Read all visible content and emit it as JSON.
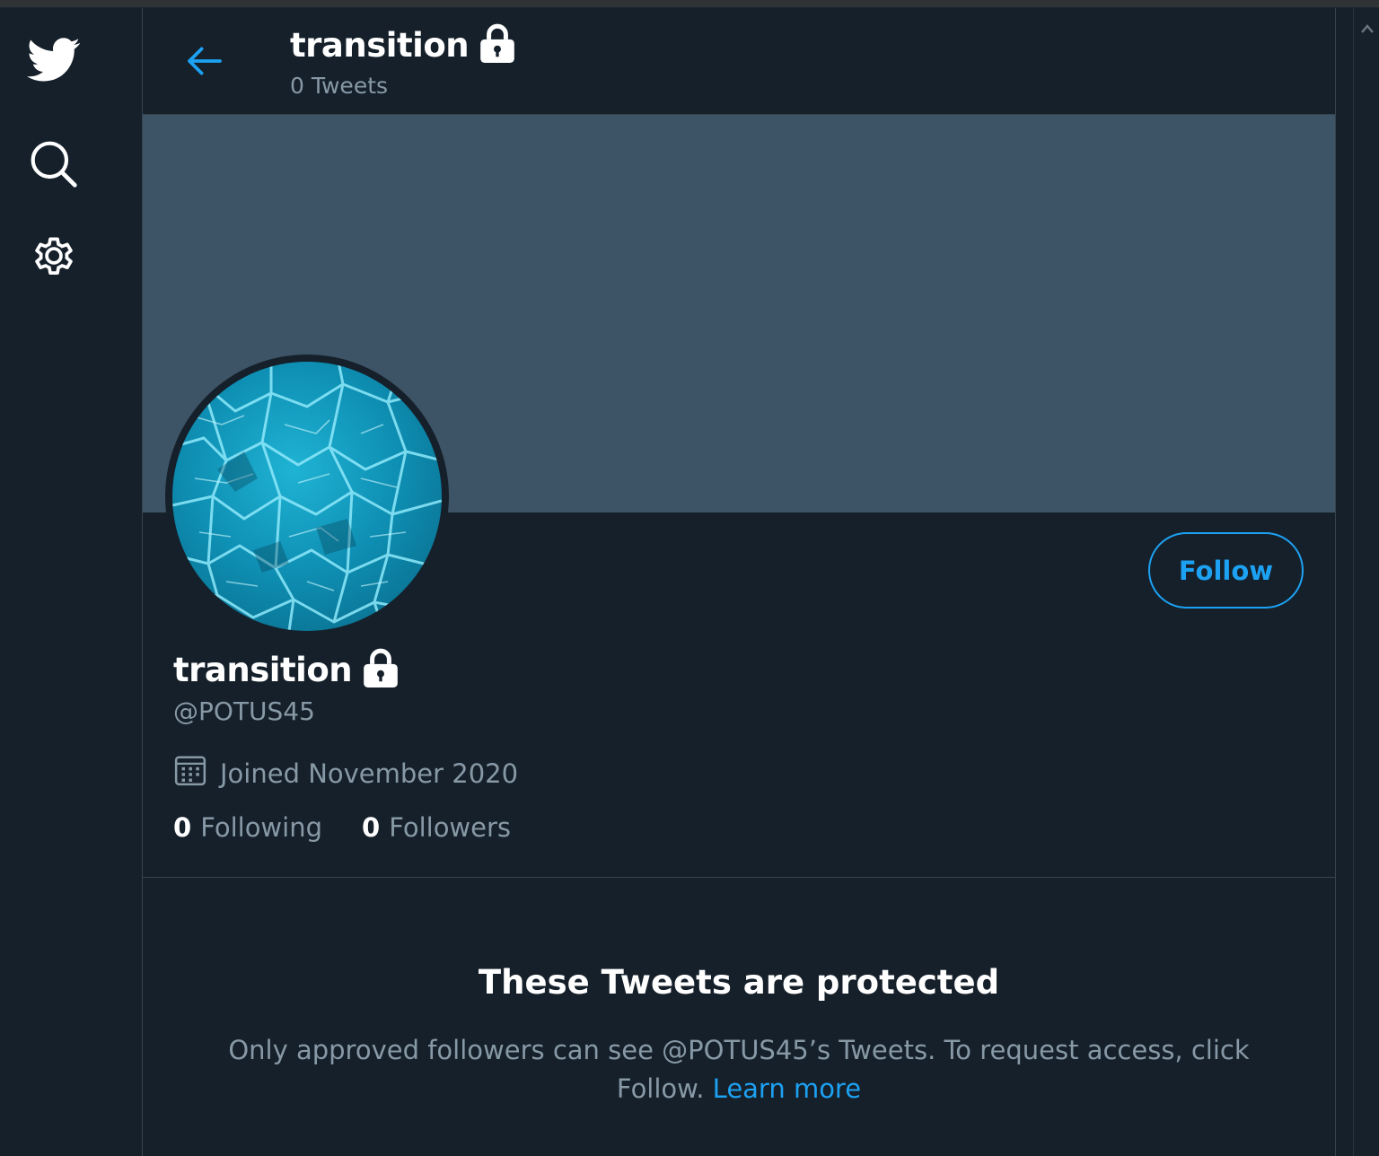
{
  "nav": {
    "items": [
      {
        "icon": "twitter-bird-icon",
        "label": ""
      },
      {
        "icon": "search-icon",
        "label": ""
      },
      {
        "icon": "gear-icon",
        "label": ""
      }
    ]
  },
  "header": {
    "title": "transition",
    "subtitle": "0 Tweets"
  },
  "profile": {
    "name": "transition",
    "handle": "@POTUS45",
    "joined": "Joined November 2020",
    "following_count": "0",
    "following_label": "Following",
    "followers_count": "0",
    "followers_label": "Followers",
    "follow_button": "Follow",
    "banner_color": "#3d5466",
    "avatar_image": "water-pool-avatar"
  },
  "protected": {
    "title": "These Tweets are protected",
    "body": "Only approved followers can see @POTUS45’s Tweets. To request access, click Follow.",
    "link": "Learn more"
  },
  "colors": {
    "background": "#15202b",
    "accent": "#1da1f2",
    "secondary_text": "#8899a6",
    "border": "#38444d"
  }
}
